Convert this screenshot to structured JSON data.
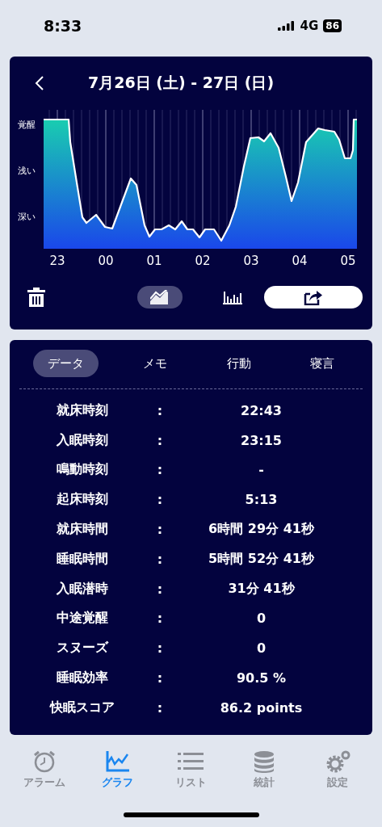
{
  "status_bar": {
    "time": "8:33",
    "network": "4G",
    "battery": "86"
  },
  "graph_card": {
    "title": "7月26日 (土) - 27日 (日)",
    "y_labels": [
      "覚醒",
      "浅い",
      "深い"
    ],
    "x_labels": [
      "23",
      "00",
      "01",
      "02",
      "03",
      "04",
      "05"
    ],
    "view_modes": [
      {
        "kind": "line",
        "selected": true
      },
      {
        "kind": "bar",
        "selected": false
      }
    ]
  },
  "detail_tabs": [
    {
      "label": "データ",
      "selected": true
    },
    {
      "label": "メモ",
      "selected": false
    },
    {
      "label": "行動",
      "selected": false
    },
    {
      "label": "寝言",
      "selected": false
    }
  ],
  "rows": [
    {
      "label": "就床時刻",
      "separator": ":",
      "value": "22:43"
    },
    {
      "label": "入眠時刻",
      "separator": ":",
      "value": "23:15"
    },
    {
      "label": "鳴動時刻",
      "separator": ":",
      "value": "-"
    },
    {
      "label": "起床時刻",
      "separator": ":",
      "value": "5:13"
    },
    {
      "label": "就床時間",
      "separator": ":",
      "value": "6時間 29分 41秒"
    },
    {
      "label": "睡眠時間",
      "separator": ":",
      "value": "5時間 52分 41秒"
    },
    {
      "label": "入眠潜時",
      "separator": ":",
      "value": "31分 41秒"
    },
    {
      "label": "中途覚醒",
      "separator": ":",
      "value": "0"
    },
    {
      "label": "スヌーズ",
      "separator": ":",
      "value": "0"
    },
    {
      "label": "睡眠効率",
      "separator": ":",
      "value": "90.5 %"
    },
    {
      "label": "快眠スコア",
      "separator": ":",
      "value": "86.2 points"
    }
  ],
  "tab_bar": [
    {
      "kind": "alarm",
      "label": "アラーム",
      "selected": false
    },
    {
      "kind": "graph",
      "label": "グラフ",
      "selected": true
    },
    {
      "kind": "list",
      "label": "リスト",
      "selected": false
    },
    {
      "kind": "stats",
      "label": "統計",
      "selected": false
    },
    {
      "kind": "settings",
      "label": "設定",
      "selected": false
    }
  ]
}
